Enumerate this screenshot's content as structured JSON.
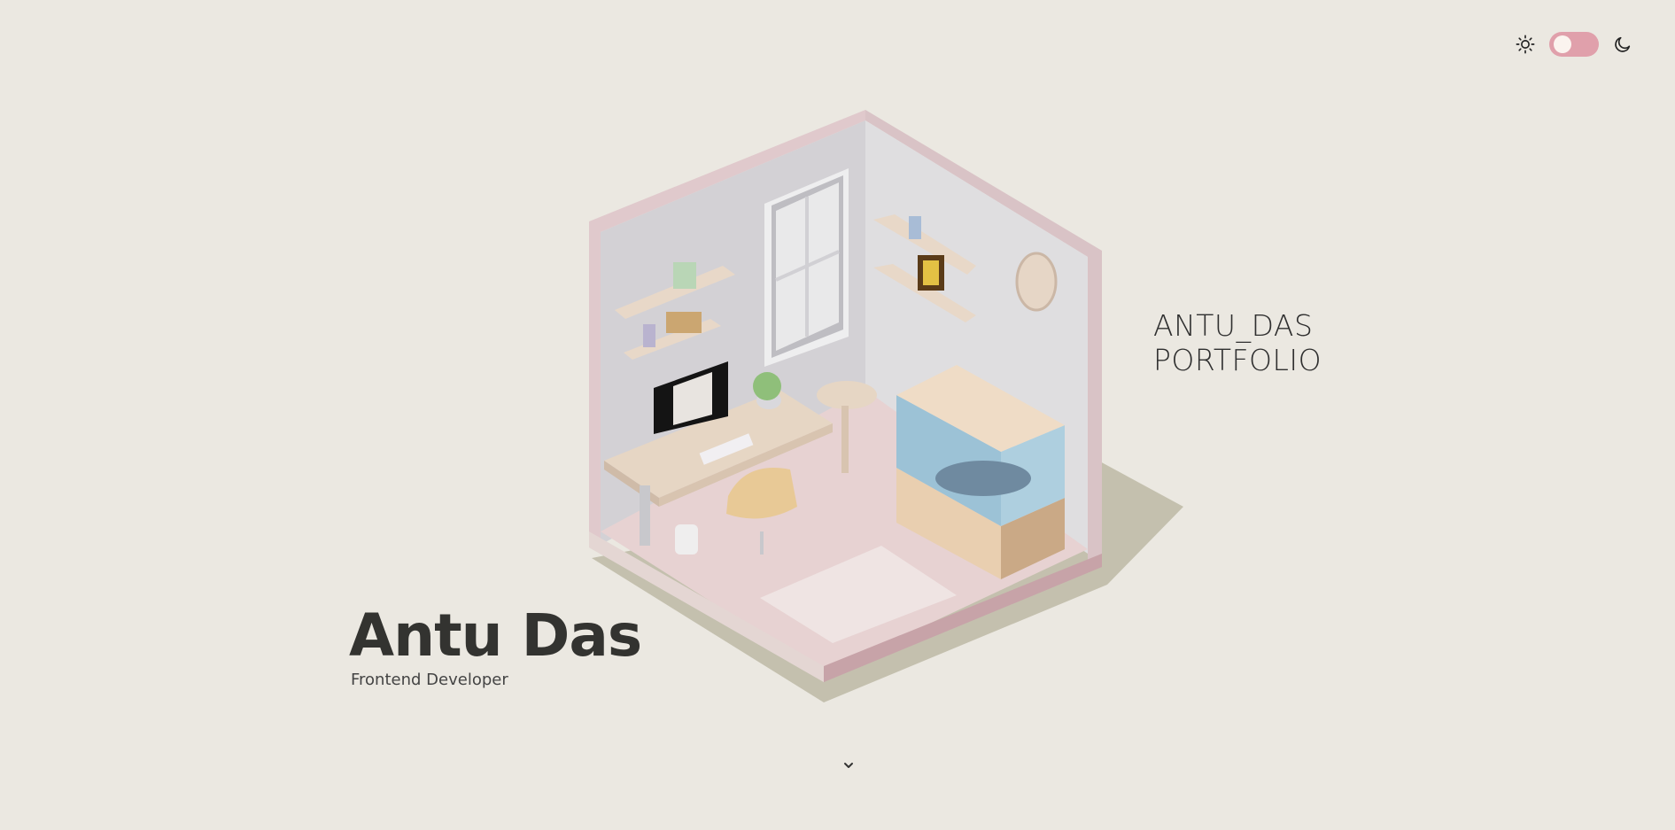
{
  "header": {
    "theme_toggle": {
      "state": "light",
      "accent": "#e0a0ab",
      "light_icon": "sun-icon",
      "dark_icon": "moon-icon"
    }
  },
  "scene": {
    "label_line1": "ANTU_DAS",
    "label_line2": "PORTFOLIO"
  },
  "hero": {
    "name": "Antu Das",
    "role": "Frontend Developer"
  },
  "scroll": {
    "icon": "chevron-down-icon"
  },
  "colors": {
    "background": "#ebe8e1",
    "text": "#333330",
    "room_floor": "#e9d3d3",
    "room_wall": "#dcdadd"
  }
}
